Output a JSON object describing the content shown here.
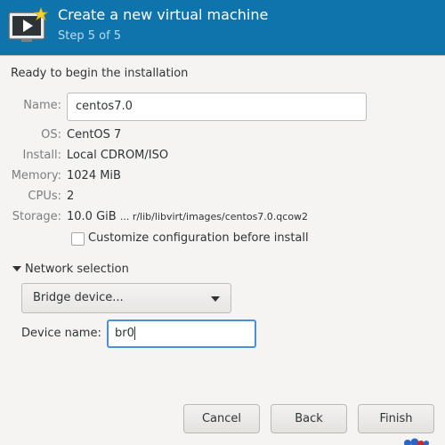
{
  "header": {
    "title": "Create a new virtual machine",
    "step": "Step 5 of 5",
    "icon": "monitor-play-star-icon",
    "background_color": "#0f74ab"
  },
  "intro": "Ready to begin the installation",
  "fields": {
    "name_label": "Name:",
    "name_value": "centos7.0",
    "os_label": "OS:",
    "os_value": "CentOS 7",
    "install_label": "Install:",
    "install_value": "Local CDROM/ISO",
    "memory_label": "Memory:",
    "memory_value": "1024 MiB",
    "cpus_label": "CPUs:",
    "cpus_value": "2",
    "storage_label": "Storage:",
    "storage_size": "10.0 GiB",
    "storage_path": "... r/lib/libvirt/images/centos7.0.qcow2"
  },
  "customize": {
    "label": "Customize configuration before install",
    "checked": false
  },
  "network": {
    "expander_label": "Network selection",
    "expanded": true,
    "source_selected": "Bridge device...",
    "device_label": "Device name:",
    "device_value": "br0"
  },
  "buttons": {
    "cancel": "Cancel",
    "back": "Back",
    "finish": "Finish"
  },
  "colors": {
    "accent": "#4a90d9",
    "header_bg": "#0f74ab"
  }
}
